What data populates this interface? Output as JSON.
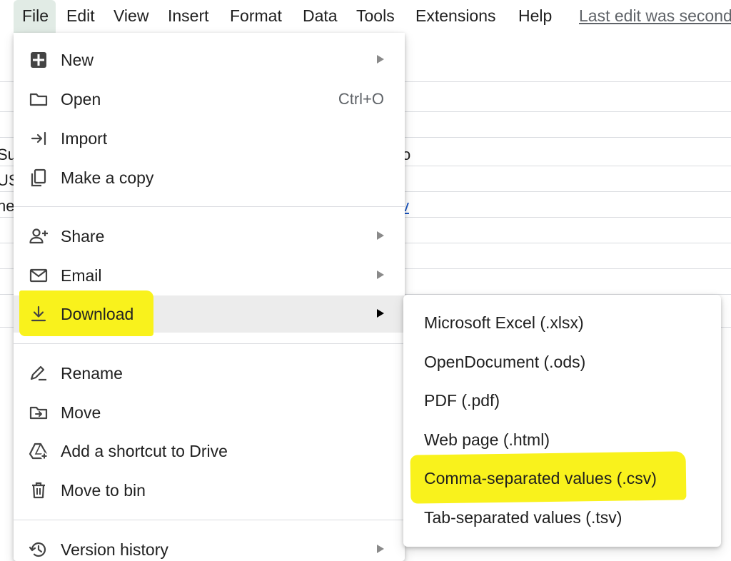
{
  "menubar": {
    "items": [
      {
        "label": "File"
      },
      {
        "label": "Edit"
      },
      {
        "label": "View"
      },
      {
        "label": "Insert"
      },
      {
        "label": "Format"
      },
      {
        "label": "Data"
      },
      {
        "label": "Tools"
      },
      {
        "label": "Extensions"
      },
      {
        "label": "Help"
      }
    ],
    "last_edit": "Last edit was seconds ago"
  },
  "sheet_fragments": {
    "r1": "Su",
    "r2": "US",
    "r3": "ne",
    "r1_right": "o",
    "r3_right": "v"
  },
  "file_menu": {
    "items": [
      {
        "label": "New",
        "icon": "new-sheet-icon",
        "has_submenu": true
      },
      {
        "label": "Open",
        "icon": "folder-icon",
        "shortcut": "Ctrl+O"
      },
      {
        "label": "Import",
        "icon": "import-icon"
      },
      {
        "label": "Make a copy",
        "icon": "copy-icon"
      },
      {
        "label": "Share",
        "icon": "share-person-icon",
        "has_submenu": true
      },
      {
        "label": "Email",
        "icon": "email-icon",
        "has_submenu": true
      },
      {
        "label": "Download",
        "icon": "download-icon",
        "has_submenu": true,
        "selected": true
      },
      {
        "label": "Rename",
        "icon": "rename-icon"
      },
      {
        "label": "Move",
        "icon": "move-folder-icon"
      },
      {
        "label": "Add a shortcut to Drive",
        "icon": "drive-shortcut-icon"
      },
      {
        "label": "Move to bin",
        "icon": "trash-icon"
      },
      {
        "label": "Version history",
        "icon": "history-icon",
        "has_submenu": true
      }
    ]
  },
  "download_submenu": {
    "items": [
      {
        "label": "Microsoft Excel (.xlsx)"
      },
      {
        "label": "OpenDocument (.ods)"
      },
      {
        "label": "PDF (.pdf)"
      },
      {
        "label": "Web page (.html)"
      },
      {
        "label": "Comma-separated values (.csv)",
        "highlighted": true
      },
      {
        "label": "Tab-separated values (.tsv)"
      }
    ]
  },
  "colors": {
    "highlight": "#f9f21c",
    "active_menubar": "#e1ebe5",
    "selected_row": "#ececec",
    "link": "#1a56c4"
  }
}
